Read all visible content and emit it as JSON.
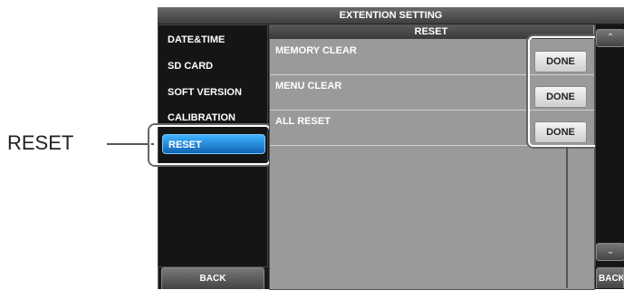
{
  "callout": {
    "label": "RESET"
  },
  "title_bar": {
    "title": "EXTENTION SETTING"
  },
  "sidebar": {
    "items": [
      {
        "label": "DATE&TIME"
      },
      {
        "label": "SD CARD"
      },
      {
        "label": "SOFT VERSION"
      },
      {
        "label": "CALIBRATION"
      },
      {
        "label": "RESET",
        "active": true
      }
    ],
    "back_label": "BACK"
  },
  "panel": {
    "header": "RESET",
    "rows": [
      {
        "label": "MEMORY CLEAR",
        "button": "DONE"
      },
      {
        "label": "MENU CLEAR",
        "button": "DONE"
      },
      {
        "label": "ALL RESET",
        "button": "DONE"
      }
    ]
  },
  "scroll": {
    "up_icon": "chevron-up-icon",
    "down_icon": "chevron-down-icon"
  },
  "right_back_label": "BACK",
  "colors": {
    "active": "#1e8ee0",
    "panel": "#9a9a9a",
    "frame": "#ffffff"
  }
}
